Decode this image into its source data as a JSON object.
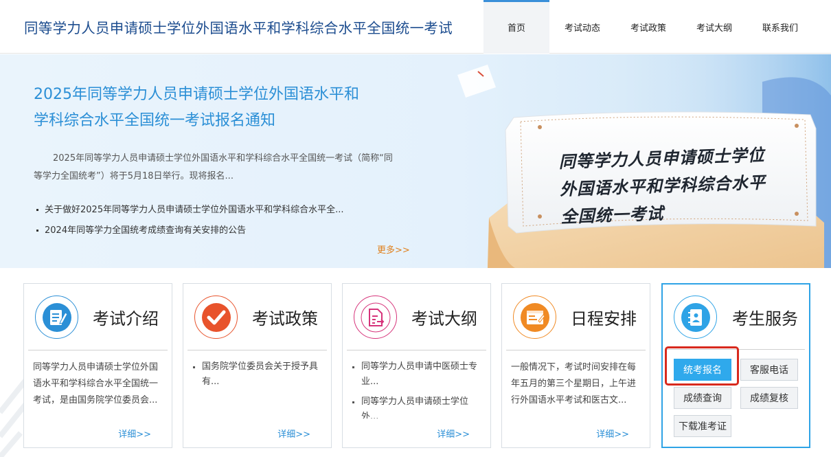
{
  "header": {
    "site_title": "同等学力人员申请硕士学位外国语水平和学科综合水平全国统一考试",
    "nav": [
      {
        "label": "首页",
        "active": true
      },
      {
        "label": "考试动态",
        "active": false
      },
      {
        "label": "考试政策",
        "active": false
      },
      {
        "label": "考试大纲",
        "active": false
      },
      {
        "label": "联系我们",
        "active": false
      }
    ]
  },
  "banner": {
    "title_line1": "2025年同等学力人员申请硕士学位外国语水平和",
    "title_line2": "学科综合水平全国统一考试报名通知",
    "summary": "2025年同等学力人员申请硕士学位外国语水平和学科综合水平全国统一考试（简称“同等学力全国统考”）将于5月18日举行。现将报名...",
    "news": [
      "关于做好2025年同等学力人员申请硕士学位外国语水平和学科综合水平全...",
      "2024年同等学力全国统考成绩查询有关安排的公告"
    ],
    "more": "更多>>",
    "scroll_line1": "同等学力人员申请硕士学位",
    "scroll_line2": "外国语水平和学科综合水平",
    "scroll_line3": "全国统一考试"
  },
  "cards": [
    {
      "title": "考试介绍",
      "icon": "document-icon",
      "color": "#2b8fd6",
      "body": "同等学力人员申请硕士学位外国语水平和学科综合水平全国统一考试，是由国务院学位委员会...",
      "detail": "详细>>"
    },
    {
      "title": "考试政策",
      "icon": "checkmark-icon",
      "color": "#e8532c",
      "items": [
        "国务院学位委员会关于授予具有..."
      ],
      "detail": "详细>>"
    },
    {
      "title": "考试大纲",
      "icon": "outline-document-icon",
      "color": "#d6337a",
      "items": [
        "同等学力人员申请中医硕士专业...",
        "同等学力人员申请硕士学位外..."
      ],
      "detail": "详细>>"
    },
    {
      "title": "日程安排",
      "icon": "schedule-icon",
      "color": "#f08a24",
      "body": "一般情况下，考试时间安排在每年五月的第三个星期日，上午进行外国语水平考试和医古文...",
      "detail": "详细>>"
    }
  ],
  "service": {
    "title": "考生服务",
    "icon": "contact-book-icon",
    "color": "#2ea3e6",
    "buttons": {
      "register": "统考报名",
      "hotline": "客服电话",
      "score_query": "成绩查询",
      "score_review": "成绩复核",
      "admission_ticket": "下载准考证"
    }
  }
}
